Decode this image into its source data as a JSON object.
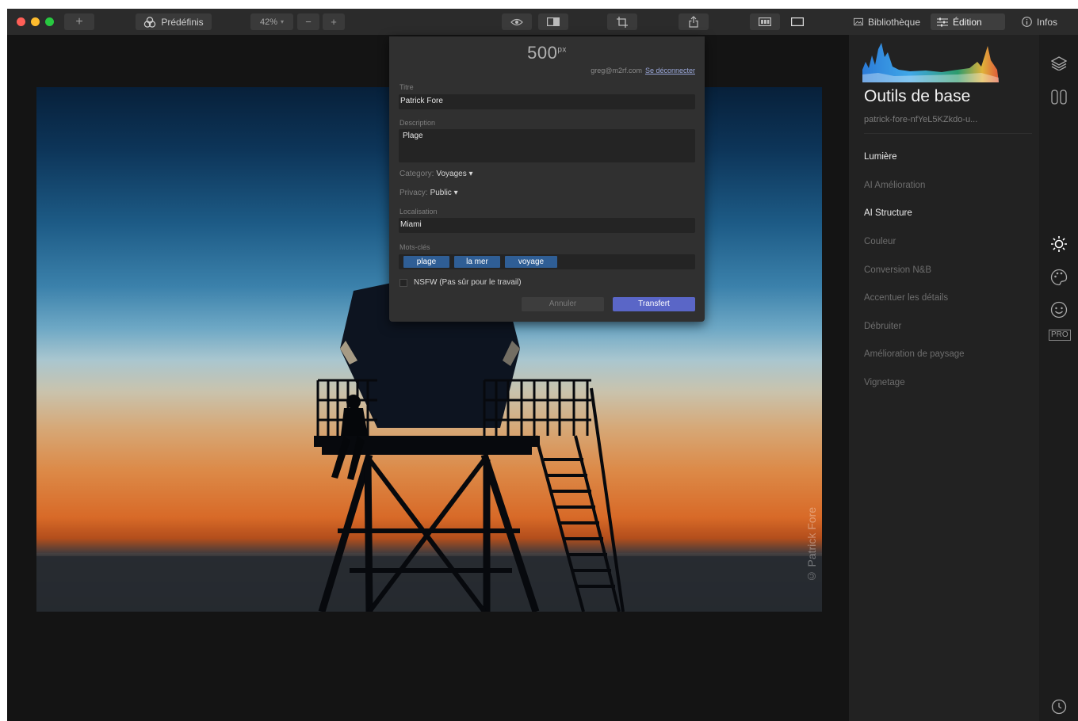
{
  "toolbar": {
    "add_label": "+",
    "presets_label": "Prédéfinis",
    "zoom_value": "42%",
    "zoom_minus": "−",
    "zoom_plus": "+",
    "tabs": [
      {
        "label": "Bibliothèque",
        "active": false
      },
      {
        "label": "Édition",
        "active": true
      },
      {
        "label": "Infos",
        "active": false
      }
    ]
  },
  "dialog": {
    "service_logo": "500",
    "service_logo_sup": "px",
    "account_email": "greg@m2rf.com",
    "logout_link": "Se déconnecter",
    "title_label": "Titre",
    "title_value": "Patrick Fore",
    "description_label": "Description",
    "description_value": "Plage",
    "category_label": "Category:",
    "category_value": "Voyages ▾",
    "privacy_label": "Privacy:",
    "privacy_value": "Public ▾",
    "location_label": "Localisation",
    "location_value": "Miami",
    "keywords_label": "Mots-clés",
    "keywords": [
      "plage",
      "la mer",
      "voyage"
    ],
    "nsfw_label": "NSFW (Pas sûr pour le travail)",
    "cancel_label": "Annuler",
    "submit_label": "Transfert"
  },
  "photo": {
    "watermark": "© Patrick Fore"
  },
  "panel": {
    "title": "Outils de base",
    "filename": "patrick-fore-nfYeL5KZkdo-u...",
    "tools": [
      {
        "label": "Lumière",
        "enabled": true
      },
      {
        "label": "AI Amélioration",
        "enabled": false
      },
      {
        "label": "AI Structure",
        "enabled": true
      },
      {
        "label": "Couleur",
        "enabled": false
      },
      {
        "label": "Conversion N&B",
        "enabled": false
      },
      {
        "label": "Accentuer les détails",
        "enabled": false
      },
      {
        "label": "Débruiter",
        "enabled": false
      },
      {
        "label": "Amélioration de paysage",
        "enabled": false
      },
      {
        "label": "Vignetage",
        "enabled": false
      }
    ]
  },
  "iconbar": {
    "pro_badge": "PRO",
    "icons": [
      "layers-icon",
      "compare-icon",
      "sun-icon",
      "palette-icon",
      "face-icon",
      "pro-icon",
      "history-icon"
    ]
  },
  "colors": {
    "accent": "#5a66c7",
    "tag_bg": "#2f5e95",
    "panel_bg": "#222222"
  }
}
